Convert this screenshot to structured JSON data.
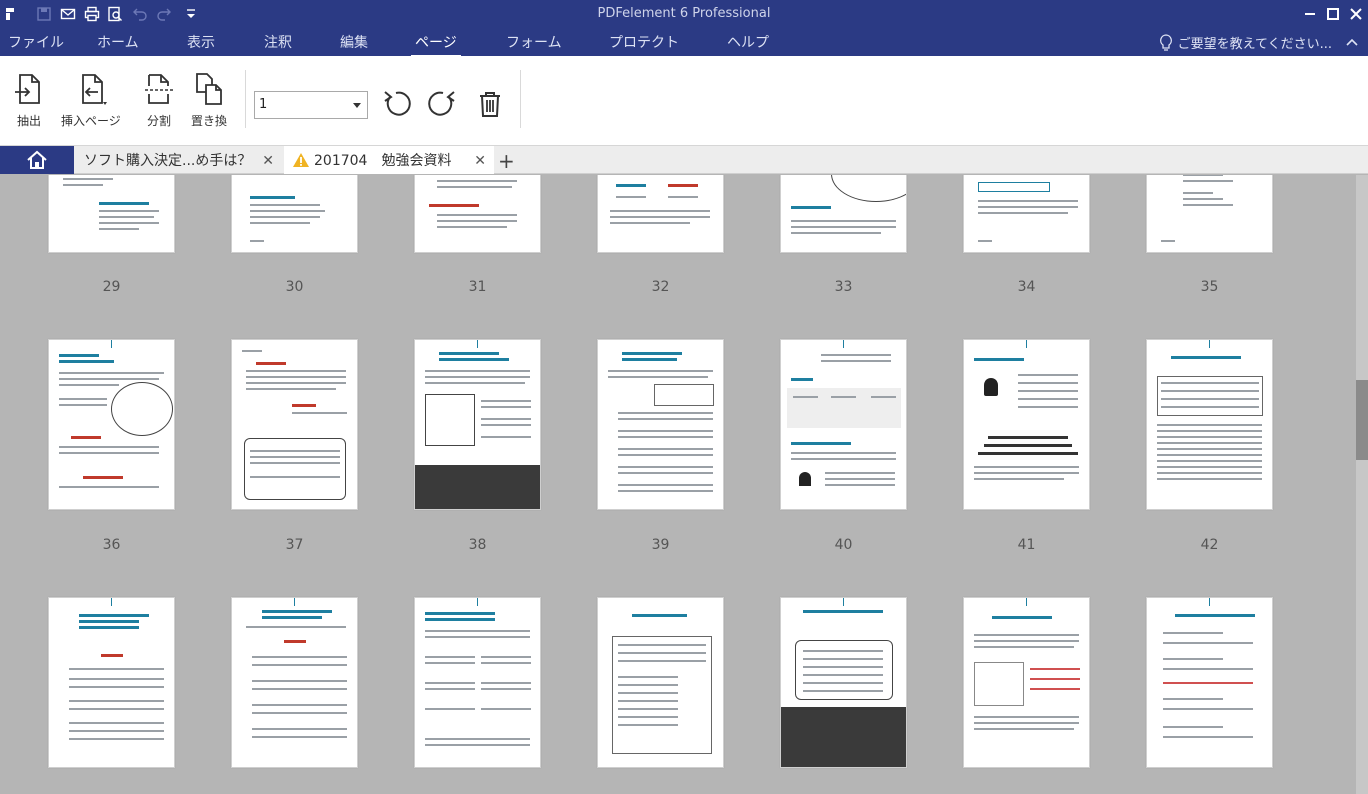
{
  "window": {
    "title": "PDFelement 6 Professional",
    "quick_access_icons": [
      "app-logo-icon",
      "save-icon",
      "email-icon",
      "print-icon",
      "print-preview-icon",
      "undo-icon",
      "redo-icon",
      "customize-toolbar-icon"
    ]
  },
  "menu": {
    "items": [
      {
        "label": "ファイル"
      },
      {
        "label": "ホーム"
      },
      {
        "label": "表示"
      },
      {
        "label": "注釈"
      },
      {
        "label": "編集"
      },
      {
        "label": "ページ",
        "active": true
      },
      {
        "label": "フォーム"
      },
      {
        "label": "プロテクト"
      },
      {
        "label": "ヘルプ"
      }
    ],
    "help_hint": "ご要望を教えてください..."
  },
  "ribbon": {
    "extract": "抽出",
    "insert_page": "挿入ページ",
    "split": "分割",
    "replace": "置き換",
    "page_value": "1"
  },
  "tabs": [
    {
      "label": "ソフト購入決定...め手は？",
      "warning": false
    },
    {
      "label": "201704　勉強会資料",
      "warning": true
    }
  ],
  "pages": [
    "29",
    "30",
    "31",
    "32",
    "33",
    "34",
    "35",
    "36",
    "37",
    "38",
    "39",
    "40",
    "41",
    "42"
  ],
  "colors": {
    "accent": "#2b3a84",
    "link": "#1e7fa0"
  }
}
